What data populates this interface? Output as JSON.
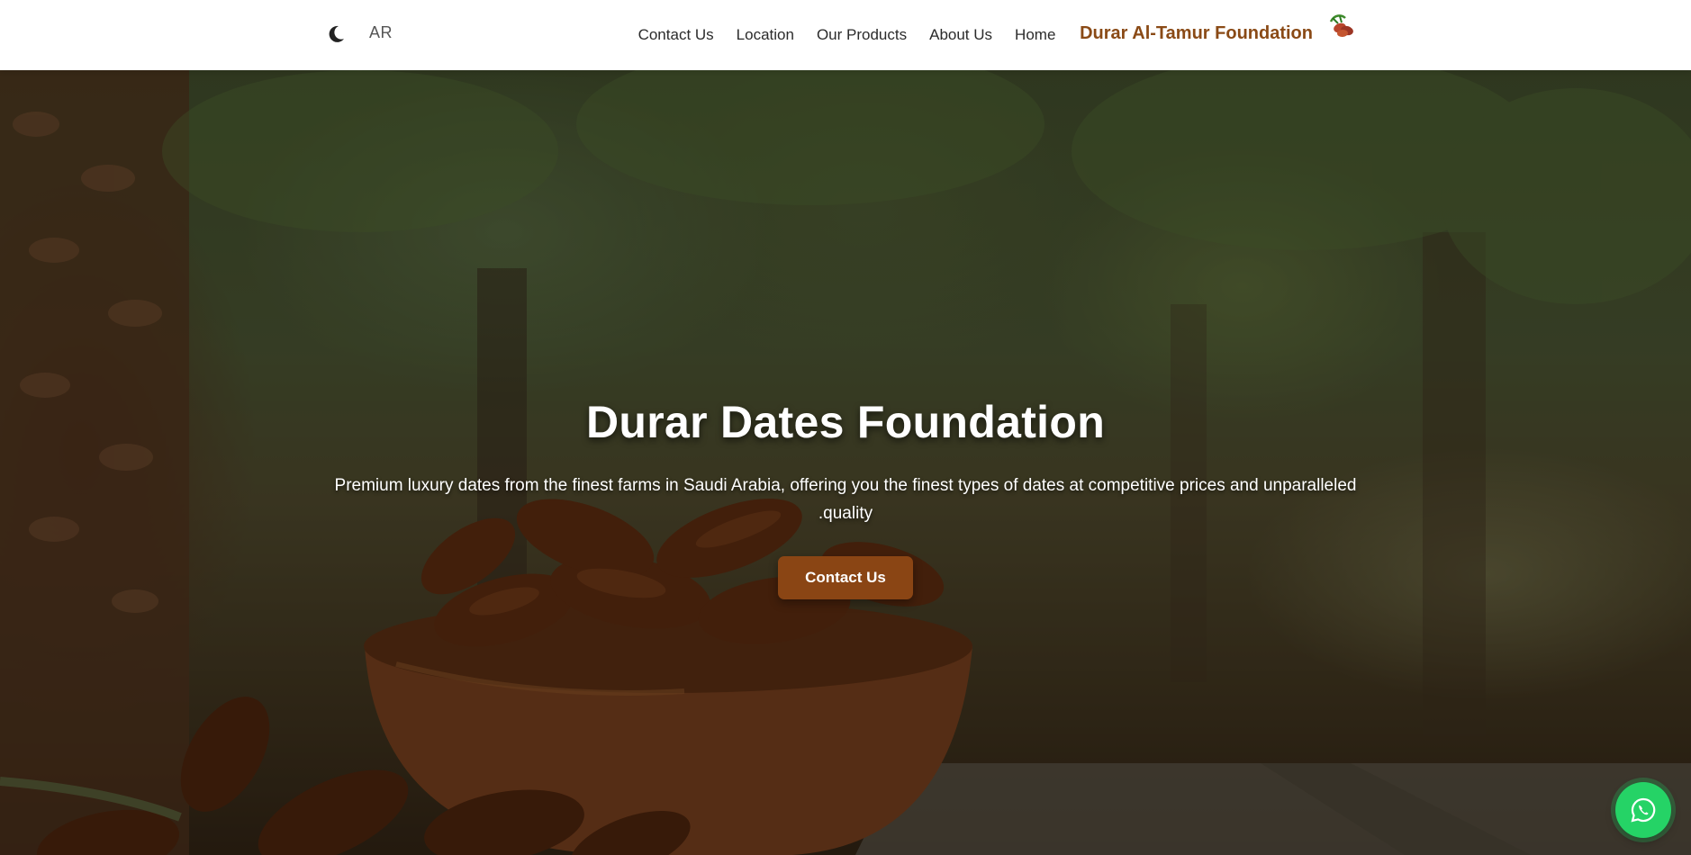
{
  "header": {
    "theme_toggle_icon": "moon-icon",
    "language_toggle": "AR",
    "nav": {
      "contact": "Contact Us",
      "location": "Location",
      "products": "Our Products",
      "about": "About Us",
      "home": "Home"
    },
    "brand_name": "Durar Al-Tamur Foundation",
    "brand_logo_icon": "dates-logo-icon"
  },
  "hero": {
    "title": "Durar Dates Foundation",
    "subtitle": "Premium luxury dates from the finest farms in Saudi Arabia, offering you the finest types of dates at competitive prices and unparalleled .quality",
    "cta_label": "Contact Us"
  },
  "floating": {
    "whatsapp_icon": "whatsapp-icon"
  },
  "colors": {
    "brand": "#8a4a16",
    "cta_background": "#8a4514",
    "whatsapp_green": "#25d366",
    "header_background": "#ffffff"
  }
}
